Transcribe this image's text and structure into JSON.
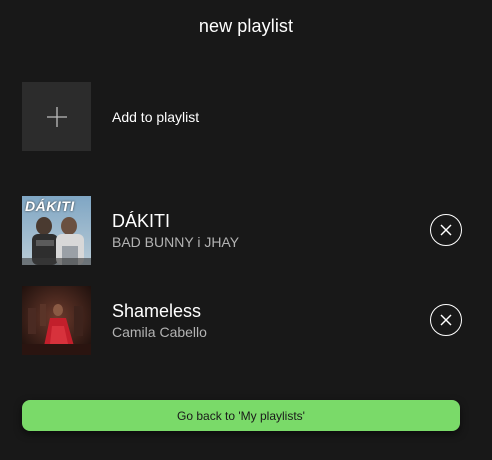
{
  "page": {
    "title": "new playlist"
  },
  "add_row": {
    "label": "Add to playlist",
    "icon": "plus-icon"
  },
  "tracks": [
    {
      "title": "DÁKITI",
      "artist": "BAD BUNNY i JHAY",
      "cover_text": "DÁKITI",
      "remove_icon": "close-circle-icon"
    },
    {
      "title": "Shameless",
      "artist": "Camila Cabello",
      "remove_icon": "close-circle-icon"
    }
  ],
  "footer": {
    "back_label": "Go back to 'My playlists'"
  },
  "colors": {
    "background": "#181818",
    "tile": "#2c2c2c",
    "accent": "#7ada69",
    "secondary_text": "#b3b3b3"
  }
}
